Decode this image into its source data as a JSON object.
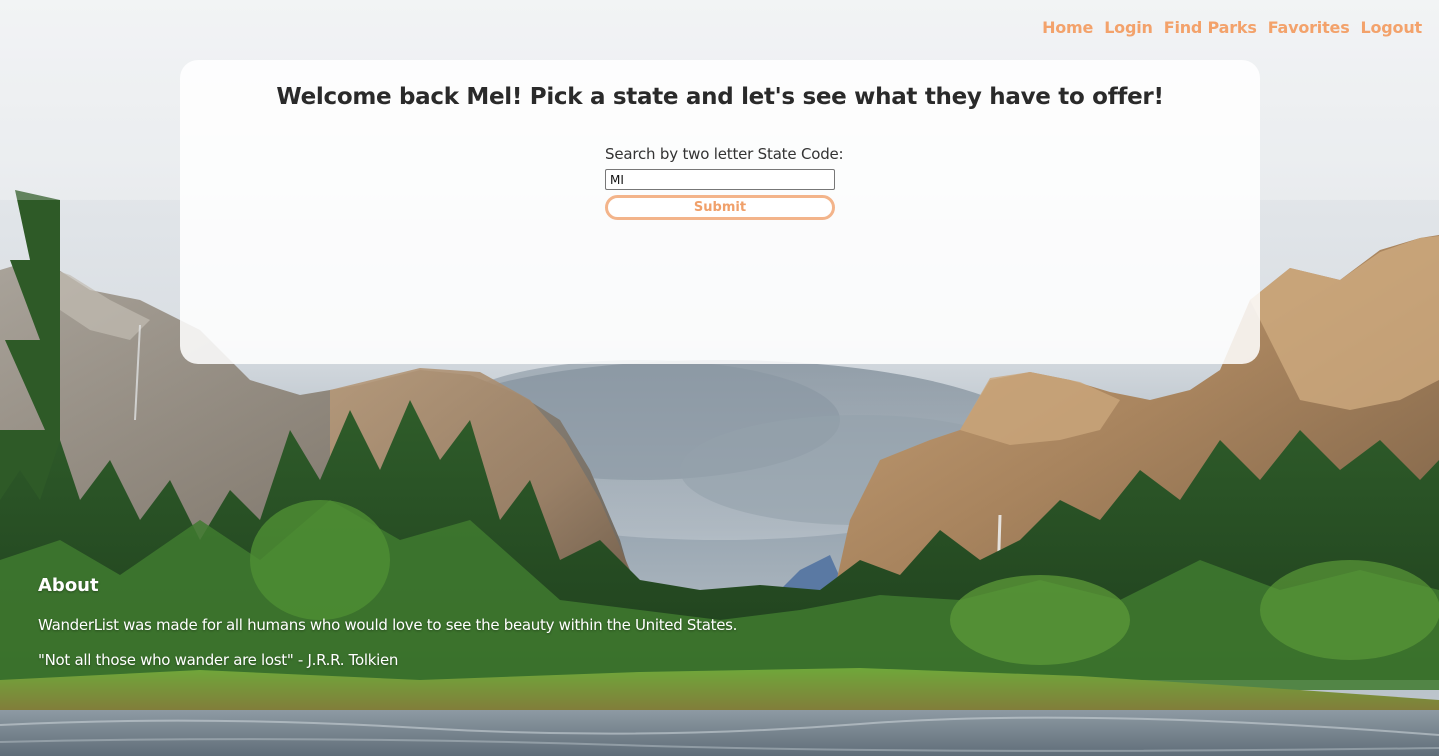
{
  "nav": {
    "items": [
      {
        "label": "Home"
      },
      {
        "label": "Login"
      },
      {
        "label": "Find Parks"
      },
      {
        "label": "Favorites"
      },
      {
        "label": "Logout"
      }
    ]
  },
  "main": {
    "heading": "Welcome back Mel! Pick a state and let's see what they have to offer!",
    "search": {
      "label": "Search by two letter State Code:",
      "value": "MI",
      "submit_label": "Submit"
    }
  },
  "about": {
    "heading": "About",
    "description": "WanderList was made for all humans who would love to see the beauty within the United States.",
    "quote": "\"Not all those who wander are lost\" - J.R.R. Tolkien"
  },
  "colors": {
    "accent": "#f3a26b",
    "card_background": "#ffffff",
    "heading_text": "#2a2a2a"
  }
}
